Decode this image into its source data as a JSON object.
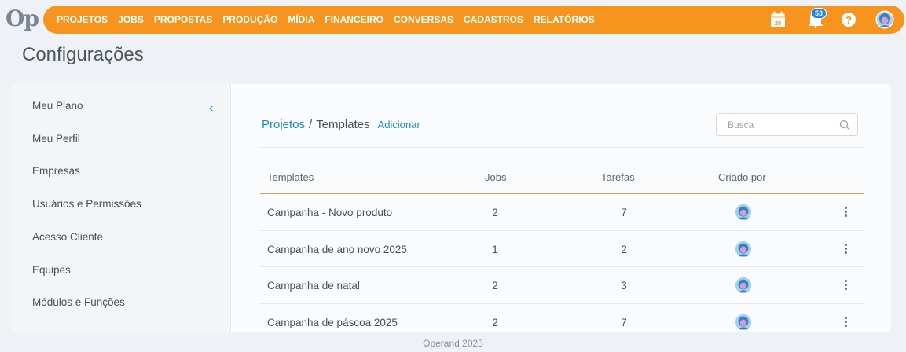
{
  "app": {
    "logo": "Op"
  },
  "nav": {
    "items": [
      "PROJETOS",
      "JOBS",
      "PROPOSTAS",
      "PRODUÇÃO",
      "MÍDIA",
      "FINANCEIRO",
      "CONVERSAS",
      "CADASTROS",
      "RELATÓRIOS"
    ],
    "calendar_day": "28",
    "notifications_count": "53",
    "help_label": "?",
    "colors": {
      "bar": "#f7941d",
      "badge": "#1e88e5"
    }
  },
  "page": {
    "title": "Configurações"
  },
  "sidebar": {
    "items": [
      "Meu Plano",
      "Meu Perfil",
      "Empresas",
      "Usuários e Permissões",
      "Acesso Cliente",
      "Equipes",
      "Módulos e Funções"
    ],
    "collapse_icon": "chevron-left-icon"
  },
  "main": {
    "breadcrumb": {
      "parent": "Projetos",
      "separator": "/",
      "current": "Templates"
    },
    "add_label": "Adicionar",
    "search": {
      "placeholder": "Busca"
    },
    "table": {
      "headers": [
        "Templates",
        "Jobs",
        "Tarefas",
        "Criado por"
      ],
      "rows": [
        {
          "name": "Campanha - Novo produto",
          "jobs": "2",
          "tasks": "7"
        },
        {
          "name": "Campanha de ano novo 2025",
          "jobs": "1",
          "tasks": "2"
        },
        {
          "name": "Campanha de natal",
          "jobs": "2",
          "tasks": "3"
        },
        {
          "name": "Campanha de páscoa 2025",
          "jobs": "2",
          "tasks": "7"
        }
      ]
    }
  },
  "footer": {
    "text": "Operand 2025"
  }
}
